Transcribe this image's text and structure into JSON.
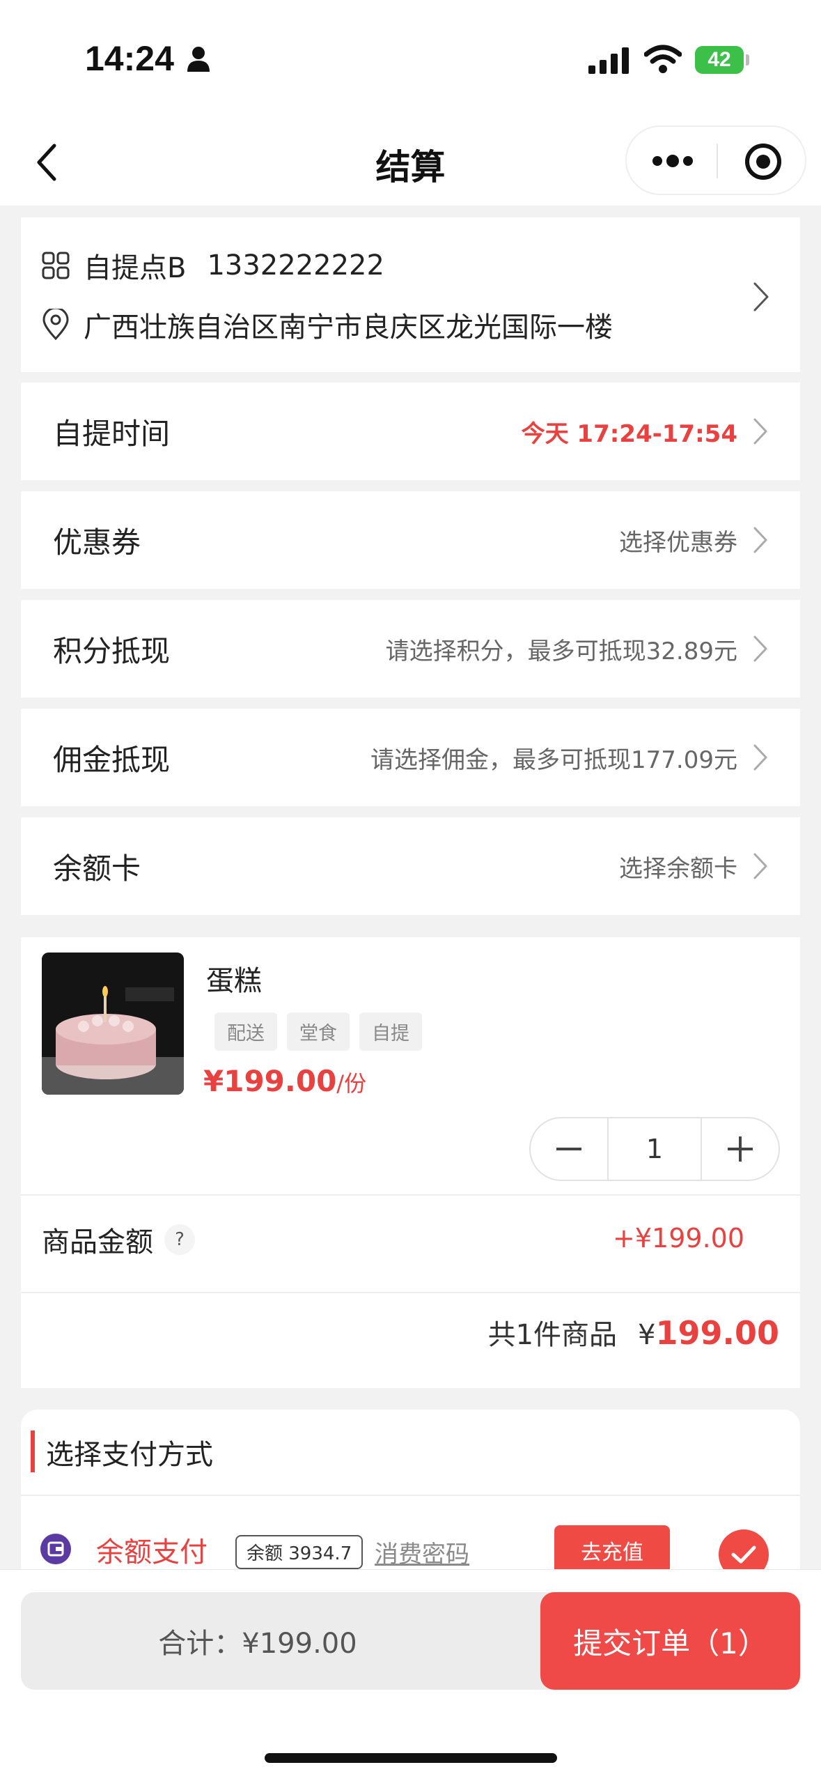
{
  "status_bar": {
    "time": "14:24",
    "battery": "42"
  },
  "nav": {
    "title": "结算"
  },
  "pickup_point": {
    "name": "自提点B",
    "phone": "1332222222",
    "address": "广西壮族自治区南宁市良庆区龙光国际一楼"
  },
  "rows": [
    {
      "label": "自提时间",
      "value": "今天 17:24-17:54",
      "highlight": true
    },
    {
      "label": "优惠券",
      "value": "选择优惠券"
    },
    {
      "label": "积分抵现",
      "value": "请选择积分，最多可抵现32.89元"
    },
    {
      "label": "佣金抵现",
      "value": "请选择佣金，最多可抵现177.09元"
    },
    {
      "label": "余额卡",
      "value": "选择余额卡"
    }
  ],
  "product": {
    "name": "蛋糕",
    "tags": [
      "配送",
      "堂食",
      "自提"
    ],
    "price": "¥199.00",
    "unit": "/份",
    "quantity": "1",
    "amount_label": "商品金额",
    "amount_help": "?",
    "amount_value": "+¥199.00",
    "total_prefix": "共1件商品",
    "total_currency": "¥",
    "total_value": "199.00"
  },
  "payment": {
    "section_title": "选择支付方式",
    "method": "余额支付",
    "balance": "余额 3934.7",
    "password_link": "消费密码",
    "recharge": "去充值"
  },
  "footer": {
    "sum_text": "合计：¥199.00",
    "submit": "提交订单（1）"
  },
  "colors": {
    "accent": "#e8413f",
    "battery": "#3cc04a",
    "wallet": "#5b3aa4"
  }
}
